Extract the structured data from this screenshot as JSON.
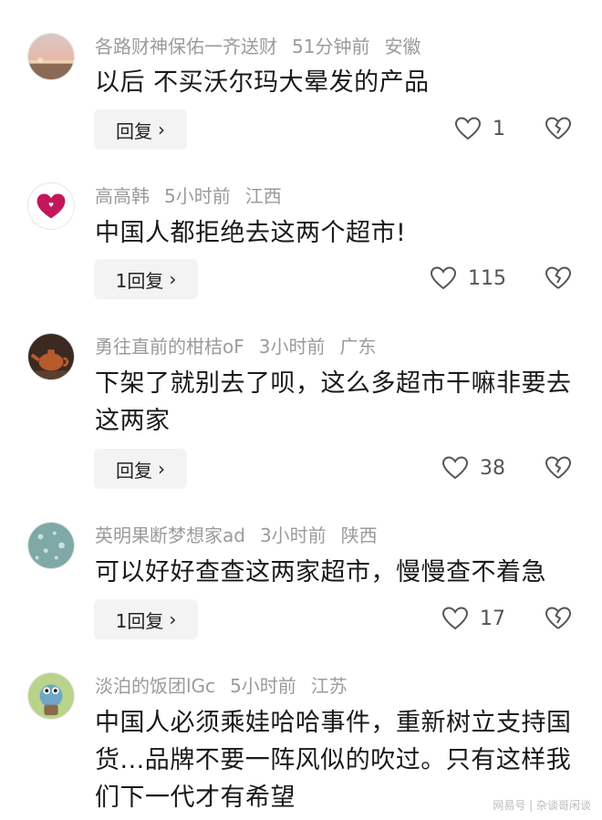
{
  "comments": [
    {
      "author": "各路财神保佑一齐送财",
      "time": "51分钟前",
      "region": "安徽",
      "text": "以后 不买沃尔玛大晕发的产品",
      "reply_label": "回复",
      "likes": "1",
      "avatar_icon": "sunset-beach-avatar"
    },
    {
      "author": "高高韩",
      "time": "5小时前",
      "region": "江西",
      "text": "中国人都拒绝去这两个超市!",
      "reply_label": "1回复",
      "likes": "115",
      "avatar_icon": "heart-logo-avatar"
    },
    {
      "author": "勇往直前的柑桔oF",
      "time": "3小时前",
      "region": "广东",
      "text": "下架了就别去了呗，这么多超市干嘛非要去这两家",
      "reply_label": "回复",
      "likes": "38",
      "avatar_icon": "teapot-avatar"
    },
    {
      "author": "英明果断梦想家ad",
      "time": "3小时前",
      "region": "陕西",
      "text": "可以好好查查这两家超市，慢慢查不着急",
      "reply_label": "1回复",
      "likes": "17",
      "avatar_icon": "water-drops-avatar"
    },
    {
      "author": "淡泊的饭团lGc",
      "time": "5小时前",
      "region": "江苏",
      "text": "中国人必须乘娃哈哈事件，重新树立支持国货...品牌不要一阵风似的吹过。只有这样我们下一代才有希望",
      "avatar_icon": "cartoon-character-avatar"
    }
  ],
  "watermark": "网易号 | 杂谈哥闲谈",
  "colors": {
    "meta_text": "#9b9b9b",
    "body_text": "#1a1a1a",
    "reply_bg": "#f3f3f3",
    "icon_stroke": "#555555"
  }
}
